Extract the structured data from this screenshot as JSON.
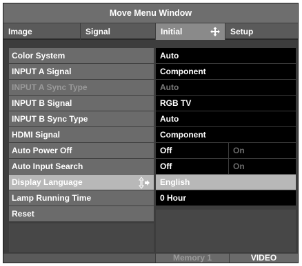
{
  "window": {
    "title": "Move Menu Window"
  },
  "tabs": [
    {
      "label": "Image"
    },
    {
      "label": "Signal"
    },
    {
      "label": "Initial"
    },
    {
      "label": "Setup"
    }
  ],
  "active_tab": "Initial",
  "rows": [
    {
      "label": "Color System",
      "value": "Auto"
    },
    {
      "label": "INPUT A Signal",
      "value": "Component"
    },
    {
      "label": "INPUT A Sync Type",
      "value": "Auto"
    },
    {
      "label": "INPUT B Signal",
      "value": "RGB TV"
    },
    {
      "label": "INPUT B Sync Type",
      "value": "Auto"
    },
    {
      "label": "HDMI Signal",
      "value": "Component"
    },
    {
      "label": "Auto Power Off",
      "value": "Off",
      "alt": "On"
    },
    {
      "label": "Auto Input Search",
      "value": "Off",
      "alt": "On"
    },
    {
      "label": "Display Language",
      "value": "English"
    },
    {
      "label": "Lamp Running Time",
      "value": "0 Hour"
    },
    {
      "label": "Reset"
    }
  ],
  "selected_row": "Display Language",
  "footer": {
    "memory": "Memory 1",
    "input": "VIDEO"
  },
  "icons": {
    "tab_move": "move-arrows-icon",
    "row_adjust": "up-down-arrows-icon"
  },
  "colors": {
    "panel": "#3d3d3d",
    "label_bg": "#6b6b6b",
    "value_bg": "#000000",
    "highlight": "#b8b8b8"
  }
}
